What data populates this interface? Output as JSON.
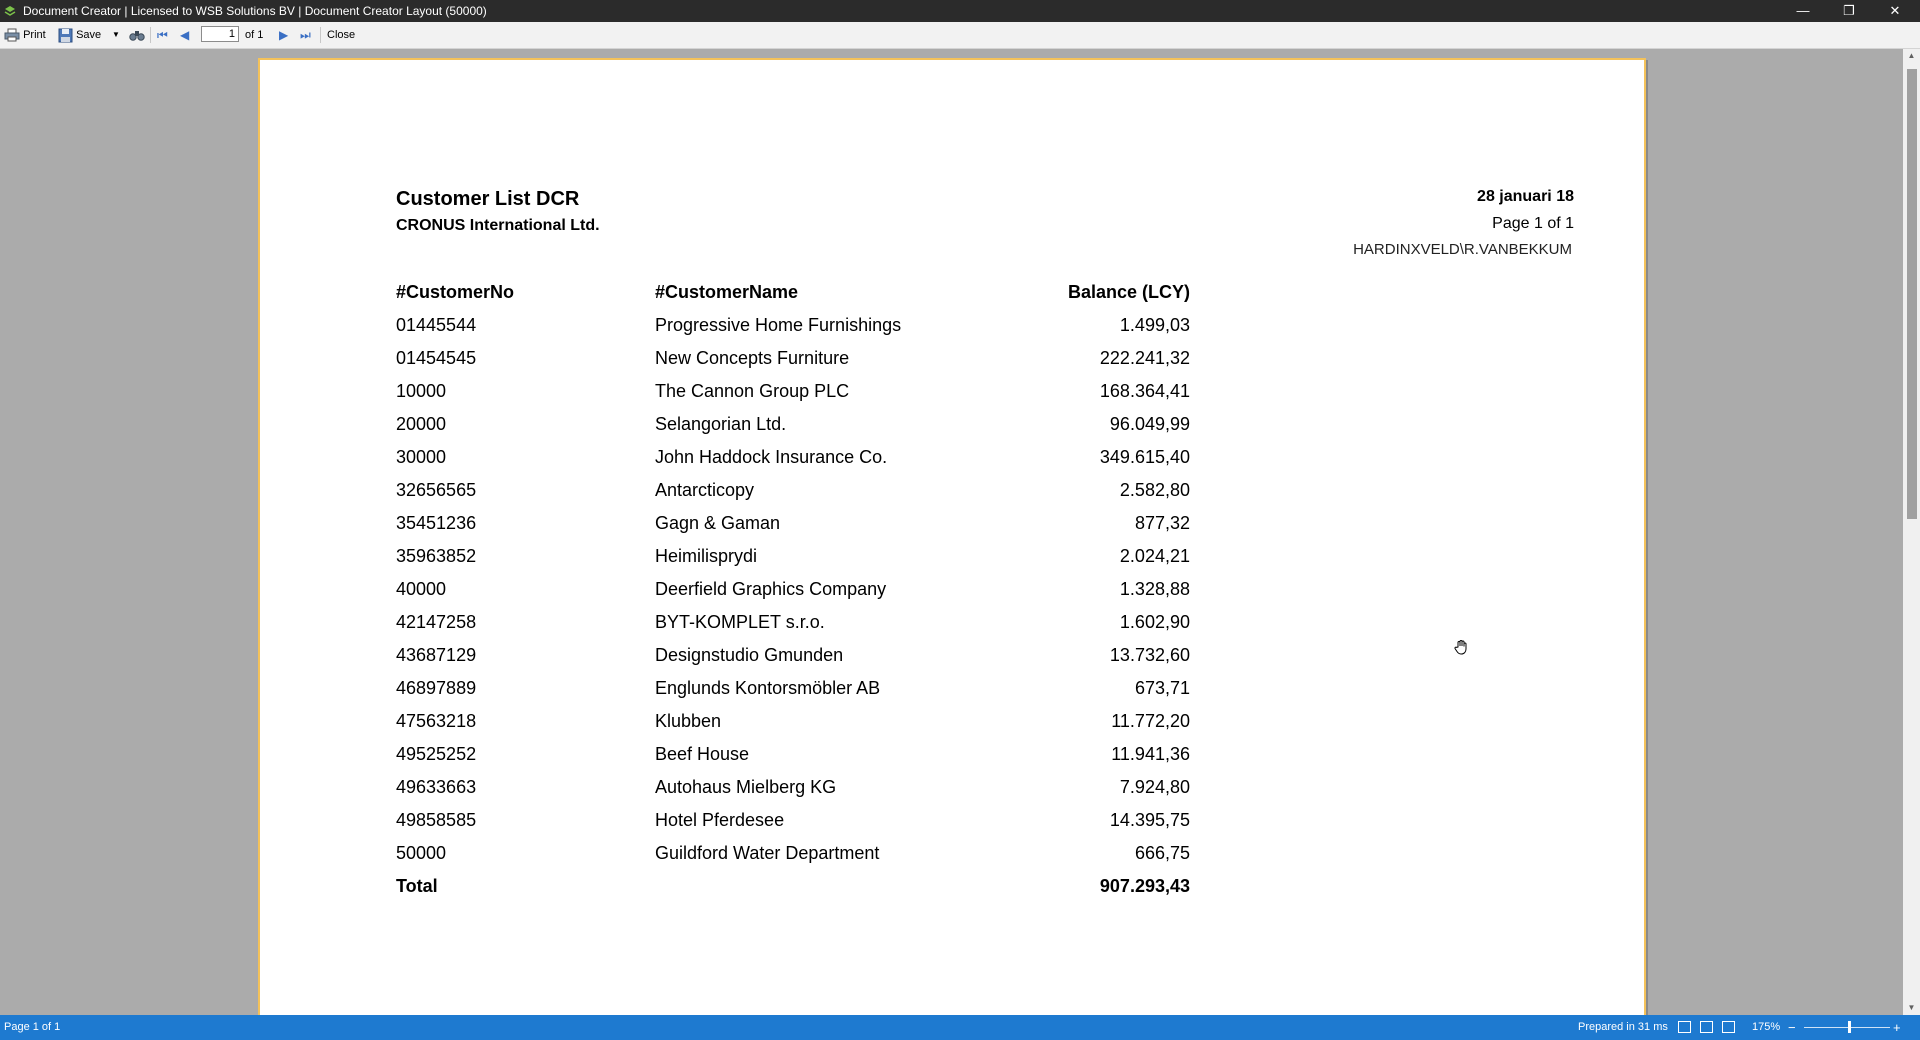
{
  "window": {
    "title": "Document Creator | Licensed to WSB Solutions BV | Document Creator Layout (50000)",
    "minimize_glyph": "—",
    "maximize_glyph": "❐",
    "close_glyph": "✕"
  },
  "toolbar": {
    "print_label": "Print",
    "save_label": "Save",
    "page_value": "1",
    "page_of": "of 1",
    "close_label": "Close"
  },
  "document": {
    "title": "Customer List DCR",
    "company": "CRONUS International Ltd.",
    "date": "28 januari 18",
    "page_label": "Page 1 of 1",
    "user": "HARDINXVELD\\R.VANBEKKUM",
    "columns": [
      "#CustomerNo",
      "#CustomerName",
      "Balance (LCY)"
    ],
    "rows": [
      {
        "no": "01445544",
        "name": "Progressive Home Furnishings",
        "balance": "1.499,03"
      },
      {
        "no": "01454545",
        "name": "New Concepts Furniture",
        "balance": "222.241,32"
      },
      {
        "no": "10000",
        "name": "The Cannon Group PLC",
        "balance": "168.364,41"
      },
      {
        "no": "20000",
        "name": "Selangorian Ltd.",
        "balance": "96.049,99"
      },
      {
        "no": "30000",
        "name": "John Haddock Insurance Co.",
        "balance": "349.615,40"
      },
      {
        "no": "32656565",
        "name": "Antarcticopy",
        "balance": "2.582,80"
      },
      {
        "no": "35451236",
        "name": "Gagn & Gaman",
        "balance": "877,32"
      },
      {
        "no": "35963852",
        "name": "Heimilisprydi",
        "balance": "2.024,21"
      },
      {
        "no": "40000",
        "name": "Deerfield Graphics Company",
        "balance": "1.328,88"
      },
      {
        "no": "42147258",
        "name": "BYT-KOMPLET s.r.o.",
        "balance": "1.602,90"
      },
      {
        "no": "43687129",
        "name": "Designstudio Gmunden",
        "balance": "13.732,60"
      },
      {
        "no": "46897889",
        "name": "Englunds Kontorsmöbler AB",
        "balance": "673,71"
      },
      {
        "no": "47563218",
        "name": "Klubben",
        "balance": "11.772,20"
      },
      {
        "no": "49525252",
        "name": "Beef House",
        "balance": "11.941,36"
      },
      {
        "no": "49633663",
        "name": "Autohaus Mielberg KG",
        "balance": "7.924,80"
      },
      {
        "no": "49858585",
        "name": "Hotel Pferdesee",
        "balance": "14.395,75"
      },
      {
        "no": "50000",
        "name": "Guildford Water Department",
        "balance": "666,75"
      }
    ],
    "total_label": "Total",
    "total_value": "907.293,43"
  },
  "statusbar": {
    "page_status": "Page 1 of 1",
    "prepared": "Prepared in 31 ms",
    "zoom": "175%",
    "zoom_level_percent": 175
  },
  "colors": {
    "titlebar": "#2b2b2b",
    "toolbar": "#f2f2f2",
    "viewport": "#ababab",
    "page_border": "#f4c25a",
    "statusbar": "#1e7ad0"
  }
}
